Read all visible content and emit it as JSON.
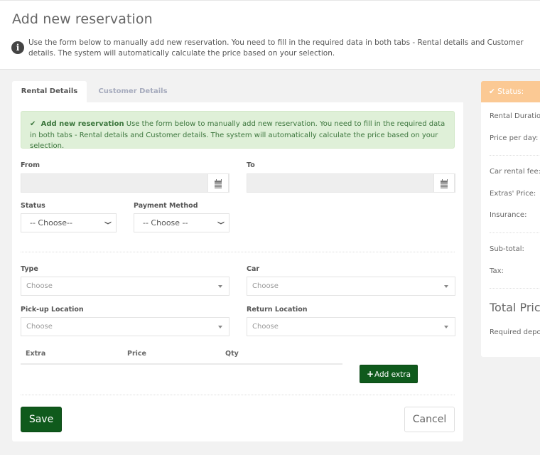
{
  "header": {
    "title": "Add new reservation",
    "info_text": "Use the form below to manually add new reservation. You need to fill in the required data in both tabs - Rental details and Customer details. The system will automatically calculate the price based on your selection."
  },
  "tabs": [
    {
      "label": "Rental Details",
      "active": true
    },
    {
      "label": "Customer Details",
      "active": false
    }
  ],
  "alert": {
    "title": "Add new reservation",
    "text": " Use the form below to manually add new reservation. You need to fill in the required data in both tabs - Rental details and Customer details. The system will automatically calculate the price based on your selection."
  },
  "form": {
    "from": {
      "label": "From",
      "value": ""
    },
    "to": {
      "label": "To",
      "value": ""
    },
    "status": {
      "label": "Status",
      "value": "-- Choose--"
    },
    "payment_method": {
      "label": "Payment Method",
      "value": "-- Choose --"
    },
    "type": {
      "label": "Type",
      "placeholder": "Choose"
    },
    "car": {
      "label": "Car",
      "placeholder": "Choose"
    },
    "pickup_location": {
      "label": "Pick-up Location",
      "placeholder": "Choose"
    },
    "return_location": {
      "label": "Return Location",
      "placeholder": "Choose"
    }
  },
  "extras": {
    "columns": [
      "Extra",
      "Price",
      "Qty"
    ],
    "rows": [],
    "add_label": "Add extra"
  },
  "actions": {
    "save_label": "Save",
    "cancel_label": "Cancel"
  },
  "status_panel": {
    "title": "Status:",
    "rental_duration": "Rental Duration:",
    "price_per_day": "Price per day:",
    "car_rental_fee": "Car rental fee:",
    "extras_price": "Extras' Price:",
    "insurance": "Insurance:",
    "subtotal": "Sub-total:",
    "tax": "Tax:",
    "total_price": "Total Price",
    "required_deposit": "Required deposit:"
  },
  "colors": {
    "primary_green": "#0f5a1c",
    "alert_bg": "#dff0d8",
    "status_header": "#fbc994"
  }
}
